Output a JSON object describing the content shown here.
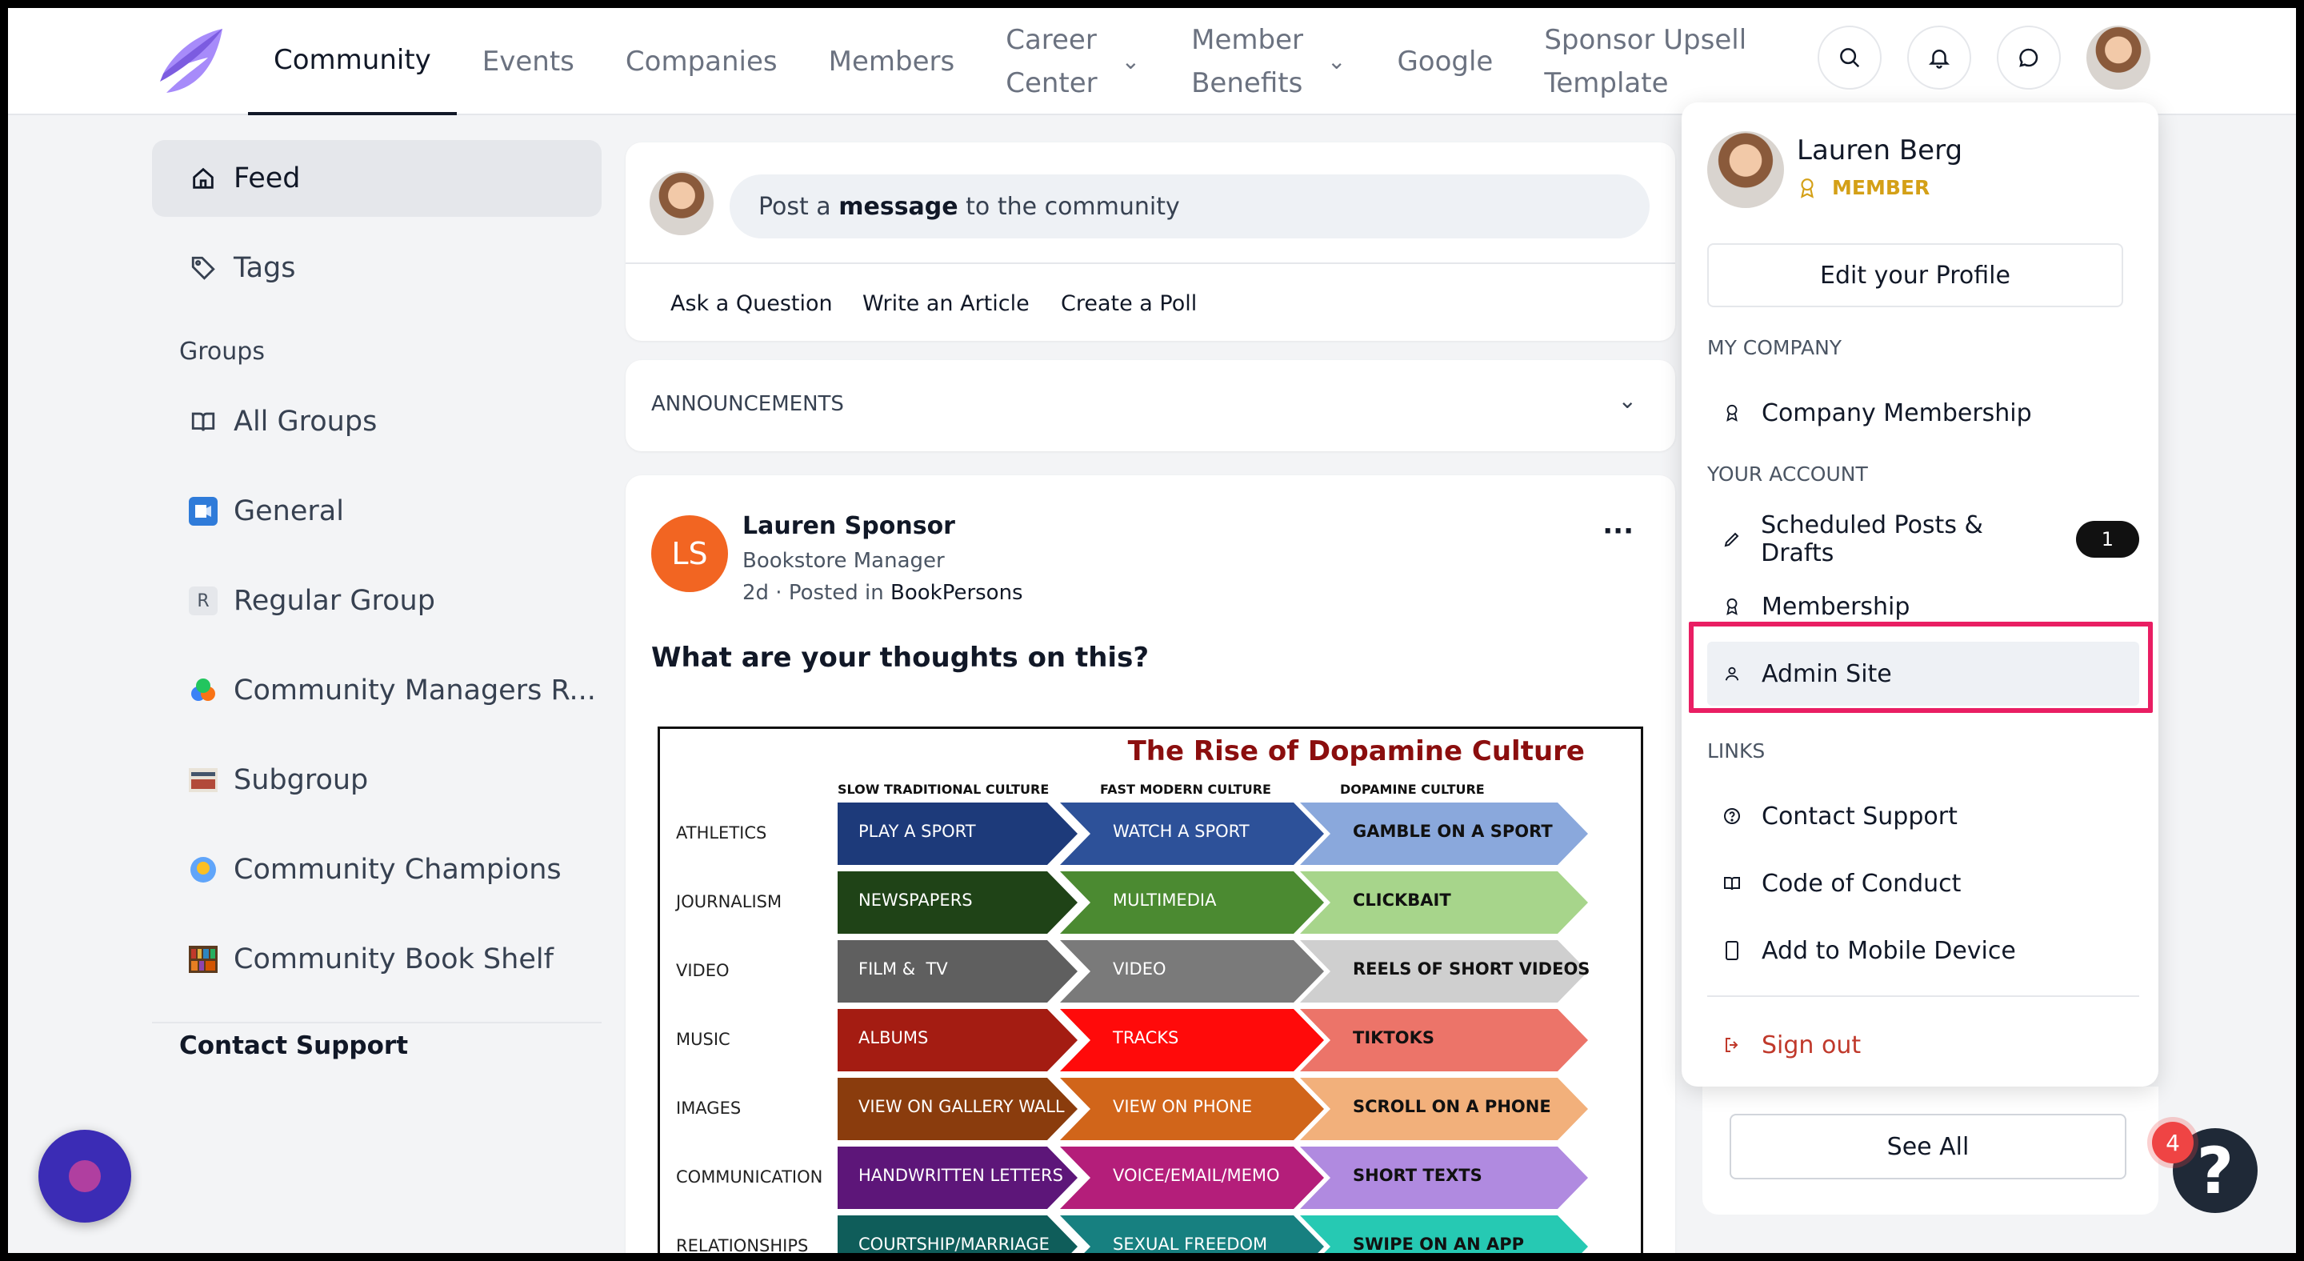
{
  "nav": {
    "items": [
      {
        "label": "Community",
        "active": true
      },
      {
        "label": "Events"
      },
      {
        "label": "Companies"
      },
      {
        "label": "Members"
      },
      {
        "label": "Career\nCenter",
        "dropdown": true
      },
      {
        "label": "Member\nBenefits",
        "dropdown": true
      },
      {
        "label": "Google"
      },
      {
        "label": "Sponsor Upsell\nTemplate"
      }
    ]
  },
  "sidebar": {
    "feed": "Feed",
    "tags": "Tags",
    "groups_heading": "Groups",
    "groups": [
      {
        "label": "All Groups"
      },
      {
        "label": "General"
      },
      {
        "label": "Regular Group",
        "letter": "R"
      },
      {
        "label": "Community Managers R..."
      },
      {
        "label": "Subgroup"
      },
      {
        "label": "Community Champions"
      },
      {
        "label": "Community Book Shelf"
      }
    ],
    "contact": "Contact Support"
  },
  "composer": {
    "placeholder_pre": "Post a ",
    "placeholder_bold": "message",
    "placeholder_post": " to the community",
    "tabs": [
      "Ask a Question",
      "Write an Article",
      "Create a Poll"
    ]
  },
  "announcements": {
    "label": "ANNOUNCEMENTS"
  },
  "post": {
    "initials": "LS",
    "author": "Lauren Sponsor",
    "role": "Bookstore Manager",
    "meta_time": "2d",
    "meta_posted": "Posted in",
    "meta_group": "BookPersons",
    "more": "···",
    "text": "What are your thoughts on this?",
    "infographic": {
      "title": "The Rise of Dopamine Culture",
      "columns": [
        "SLOW TRADITIONAL CULTURE",
        "FAST MODERN CULTURE",
        "DOPAMINE CULTURE"
      ],
      "rows": [
        {
          "label": "ATHLETICS",
          "cells": [
            "PLAY A SPORT",
            "WATCH A SPORT",
            "GAMBLE ON A SPORT"
          ],
          "colors": [
            "#1d3a7a",
            "#2d5199",
            "#8aa8dc"
          ],
          "dark_text_last": true
        },
        {
          "label": "JOURNALISM",
          "cells": [
            "NEWSPAPERS",
            "MULTIMEDIA",
            "CLICKBAIT"
          ],
          "colors": [
            "#1f4317",
            "#4b8a31",
            "#a7d58b"
          ],
          "dark_text_last": true
        },
        {
          "label": "VIDEO",
          "cells": [
            "FILM &  TV",
            "VIDEO",
            "REELS OF SHORT VIDEOS"
          ],
          "colors": [
            "#5f5f5f",
            "#7a7a7a",
            "#cfcfcf"
          ],
          "dark_text_last": true
        },
        {
          "label": "MUSIC",
          "cells": [
            "ALBUMS",
            "TRACKS",
            "TIKTOKS"
          ],
          "colors": [
            "#a41c12",
            "#ff0a0a",
            "#ec7469"
          ],
          "dark_text_last": true
        },
        {
          "label": "IMAGES",
          "cells": [
            "VIEW ON GALLERY WALL",
            "VIEW ON PHONE",
            "SCROLL ON A PHONE"
          ],
          "colors": [
            "#8a3c0d",
            "#d1651a",
            "#f2b07b"
          ],
          "dark_text_last": true
        },
        {
          "label": "COMMUNICATION",
          "cells": [
            "HANDWRITTEN LETTERS",
            "VOICE/EMAIL/MEMO",
            "SHORT TEXTS"
          ],
          "colors": [
            "#5d1679",
            "#b41e7a",
            "#b08ae0"
          ],
          "dark_text_last": true
        },
        {
          "label": "RELATIONSHIPS",
          "cells": [
            "COURTSHIP/MARRIAGE",
            "SEXUAL FREEDOM",
            "SWIPE ON AN APP"
          ],
          "colors": [
            "#0f5d5a",
            "#178080",
            "#26c9b3"
          ],
          "dark_text_last": true
        }
      ]
    }
  },
  "dropdown": {
    "name": "Lauren Berg",
    "badge": "MEMBER",
    "edit_profile": "Edit your Profile",
    "sec_company": "MY COMPANY",
    "company_membership": "Company Membership",
    "sec_account": "YOUR ACCOUNT",
    "scheduled": "Scheduled Posts & Drafts",
    "scheduled_count": "1",
    "membership": "Membership",
    "admin": "Admin Site",
    "sec_links": "LINKS",
    "contact": "Contact Support",
    "conduct": "Code of Conduct",
    "mobile": "Add to Mobile Device",
    "signout": "Sign out"
  },
  "see_all": "See All",
  "help": {
    "badge": "4",
    "symbol": "?"
  },
  "colors": {
    "accent": "#e91e63",
    "signout": "#c0392b",
    "badge_gold": "#d4a017",
    "ls_avatar": "#f26522",
    "logo": "#9b7fe6"
  }
}
